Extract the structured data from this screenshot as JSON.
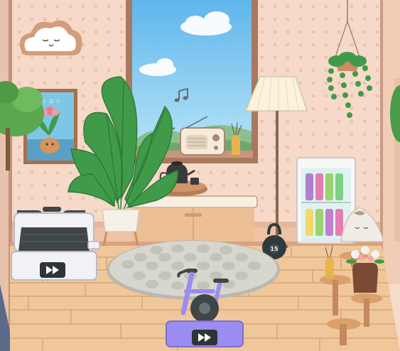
{
  "scene": {
    "room": "home gym",
    "colors": {
      "wall": "#f6d9c8",
      "wall_pattern": "#e7b9a6",
      "floor": "#f0c79a",
      "floor_line": "#d9a673",
      "trim": "#b8866a",
      "sky": "#7cc7ef",
      "plant": "#3f9b4a",
      "bike": "#9a8cf0",
      "treadmill": "#f2f2f6",
      "rug": "#cfcfc6"
    }
  },
  "kettlebell": {
    "weight_label": "15"
  },
  "icons": [
    "cloud-face-icon",
    "music-note-icon",
    "play-forward-icon"
  ]
}
